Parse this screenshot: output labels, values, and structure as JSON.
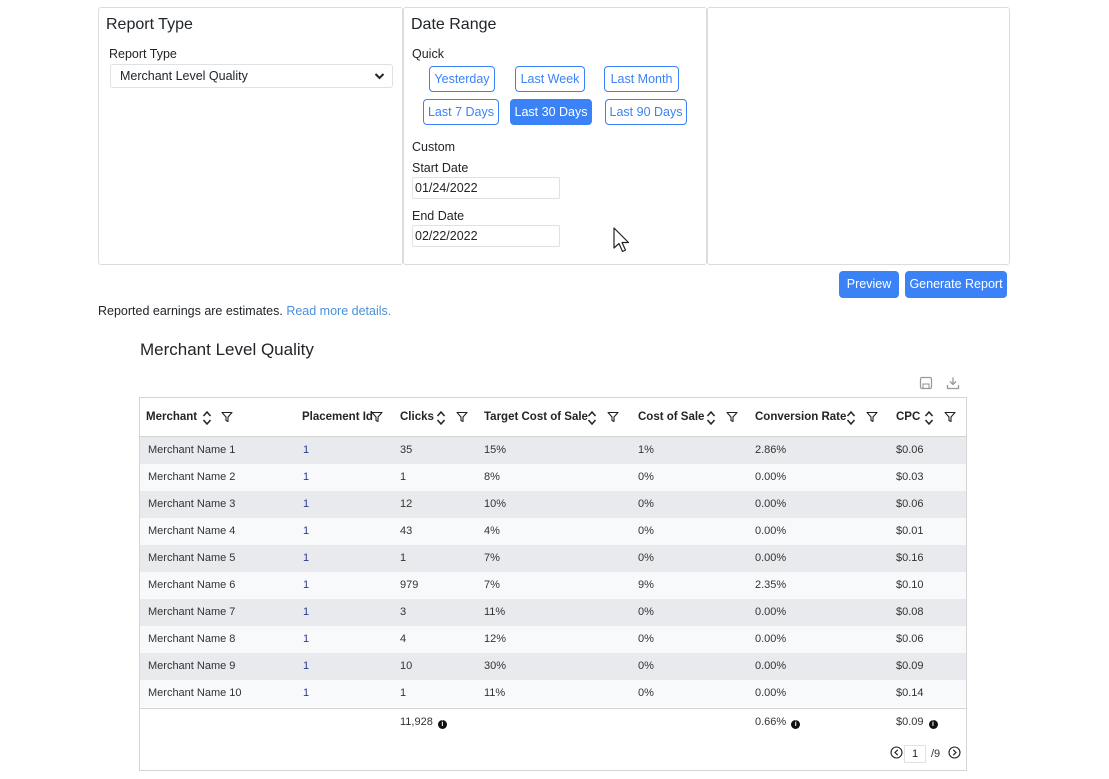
{
  "report_type": {
    "title": "Report Type",
    "label": "Report Type",
    "selected": "Merchant Level Quality"
  },
  "date_range": {
    "title": "Date Range",
    "quick_label": "Quick",
    "quick_buttons": [
      "Yesterday",
      "Last Week",
      "Last Month",
      "Last 7 Days",
      "Last 30 Days",
      "Last 90 Days"
    ],
    "active_quick": "Last 30 Days",
    "custom_label": "Custom",
    "start_label": "Start Date",
    "start_value": "01/24/2022",
    "end_label": "End Date",
    "end_value": "02/22/2022"
  },
  "actions": {
    "preview": "Preview",
    "generate": "Generate Report"
  },
  "note": {
    "text": "Reported earnings are estimates.",
    "link": "Read more details."
  },
  "report": {
    "title": "Merchant Level Quality",
    "columns": [
      "Merchant",
      "Placement Id",
      "Clicks",
      "Target Cost of Sale",
      "Cost of Sale",
      "Conversion Rate",
      "CPC"
    ],
    "rows": [
      [
        "Merchant Name 1",
        "1",
        "35",
        "15%",
        "1%",
        "2.86%",
        "$0.06"
      ],
      [
        "Merchant Name 2",
        "1",
        "1",
        "8%",
        "0%",
        "0.00%",
        "$0.03"
      ],
      [
        "Merchant Name 3",
        "1",
        "12",
        "10%",
        "0%",
        "0.00%",
        "$0.06"
      ],
      [
        "Merchant Name 4",
        "1",
        "43",
        "4%",
        "0%",
        "0.00%",
        "$0.01"
      ],
      [
        "Merchant Name 5",
        "1",
        "1",
        "7%",
        "0%",
        "0.00%",
        "$0.16"
      ],
      [
        "Merchant Name 6",
        "1",
        "979",
        "7%",
        "9%",
        "2.35%",
        "$0.10"
      ],
      [
        "Merchant Name 7",
        "1",
        "3",
        "11%",
        "0%",
        "0.00%",
        "$0.08"
      ],
      [
        "Merchant Name 8",
        "1",
        "4",
        "12%",
        "0%",
        "0.00%",
        "$0.06"
      ],
      [
        "Merchant Name 9",
        "1",
        "10",
        "30%",
        "0%",
        "0.00%",
        "$0.09"
      ],
      [
        "Merchant Name 10",
        "1",
        "1",
        "11%",
        "0%",
        "0.00%",
        "$0.14"
      ]
    ],
    "totals": {
      "clicks": "11,928",
      "conversion_rate": "0.66%",
      "cpc": "$0.09"
    },
    "pager": {
      "current": "1",
      "total": "/9"
    }
  },
  "colors": {
    "accent": "#3b82f6",
    "row_alt": "#e9eaed",
    "row_norm": "#f8f9fb"
  },
  "icons": [
    "chevron-down-icon",
    "sort-icon",
    "filter-icon",
    "save-icon",
    "download-icon",
    "info-icon",
    "prev-page-icon",
    "next-page-icon",
    "mouse-cursor-icon"
  ]
}
